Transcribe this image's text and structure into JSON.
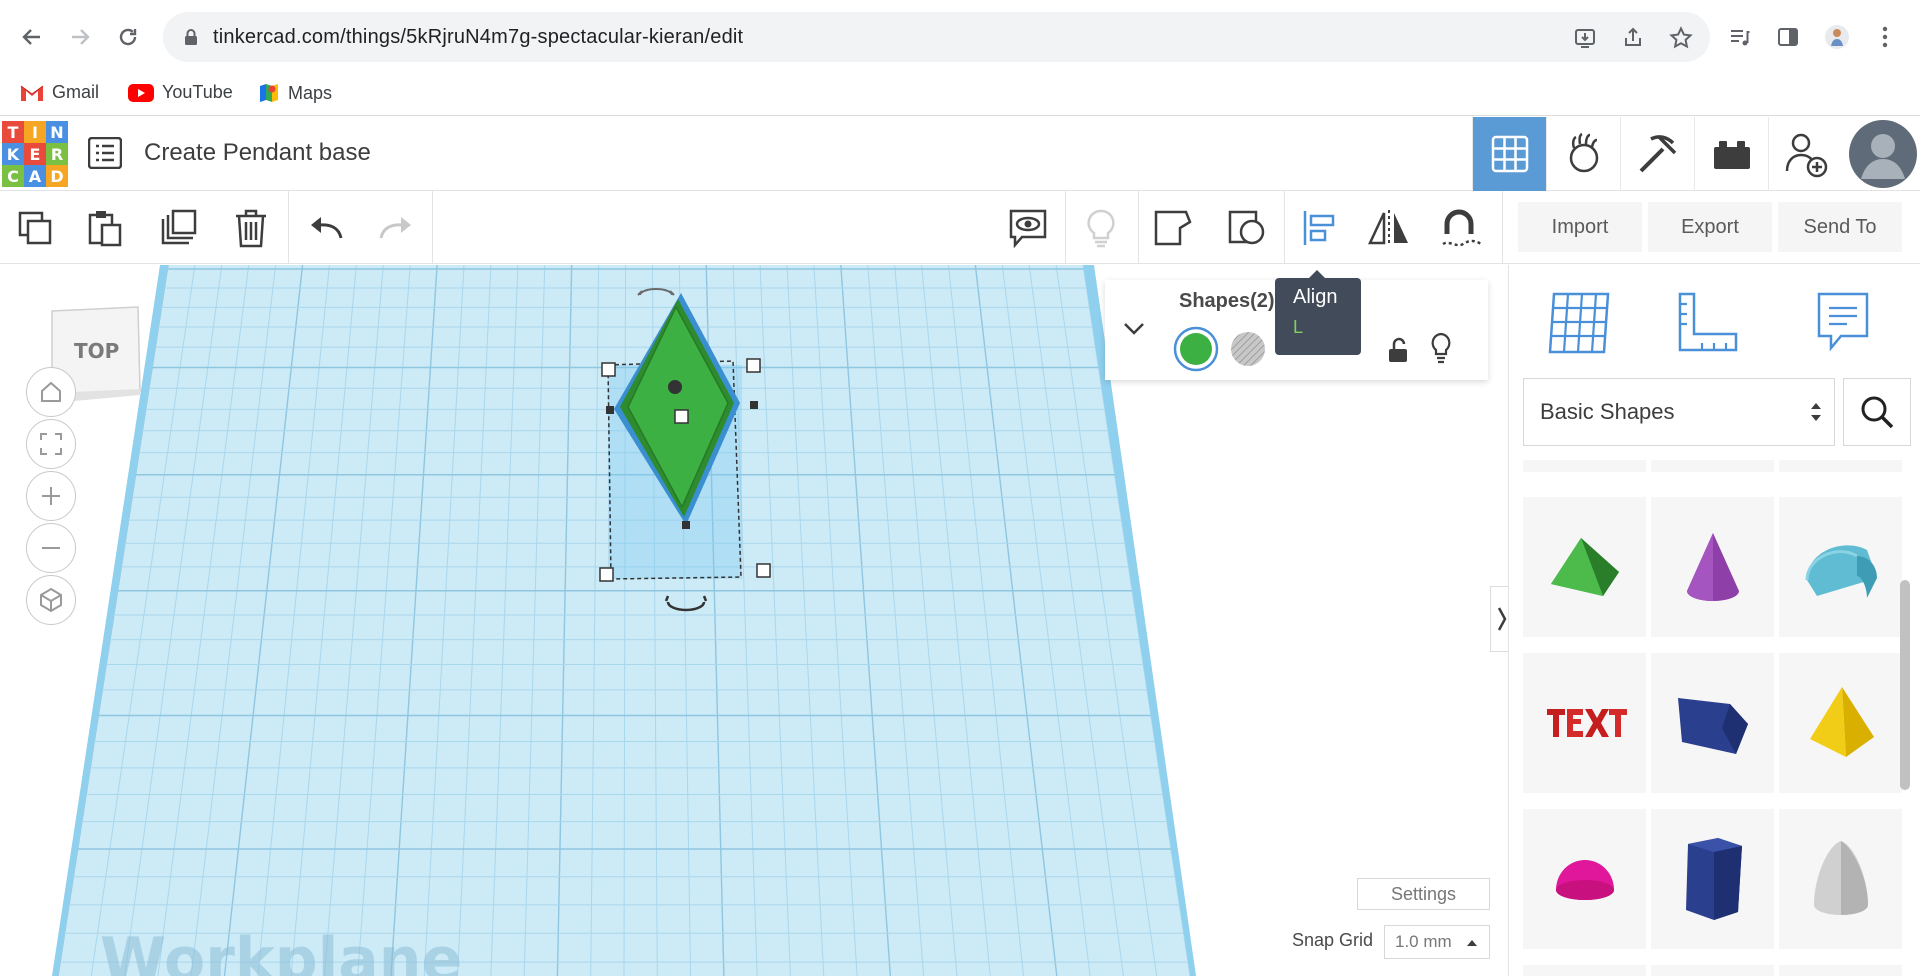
{
  "browser": {
    "url": "tinkercad.com/things/5kRjruN4m7g-spectacular-kieran/edit",
    "bookmarks": [
      {
        "label": "Gmail",
        "icon": "gmail-icon"
      },
      {
        "label": "YouTube",
        "icon": "youtube-icon"
      },
      {
        "label": "Maps",
        "icon": "maps-icon"
      }
    ]
  },
  "app": {
    "logo_letters": [
      "T",
      "I",
      "N",
      "K",
      "E",
      "R",
      "C",
      "A",
      "D"
    ],
    "logo_colors": [
      "#e84a3b",
      "#f6a623",
      "#4a90e2",
      "#4a90e2",
      "#e84a3b",
      "#7ac143",
      "#7ac143",
      "#4a90e2",
      "#f6a623"
    ],
    "design_title": "Create Pendant base",
    "accent": "#5b9bd5"
  },
  "toolbar": {
    "import_label": "Import",
    "export_label": "Export",
    "send_to_label": "Send To"
  },
  "viewport": {
    "viewcube_label": "TOP",
    "workplane_label": "Workplane",
    "settings_label": "Settings",
    "snap_grid_label": "Snap Grid",
    "snap_grid_value": "1.0 mm"
  },
  "inspector": {
    "title": "Shapes(2)",
    "solid_color": "#3cb043"
  },
  "tooltip": {
    "title": "Align",
    "shortcut": "L"
  },
  "shapes_panel": {
    "category": "Basic Shapes",
    "shapes": [
      "Roof",
      "Cone",
      "Half Cylinder",
      "Text",
      "Wedge",
      "Pyramid",
      "Half Sphere",
      "Polygon",
      "Paraboloid"
    ]
  }
}
